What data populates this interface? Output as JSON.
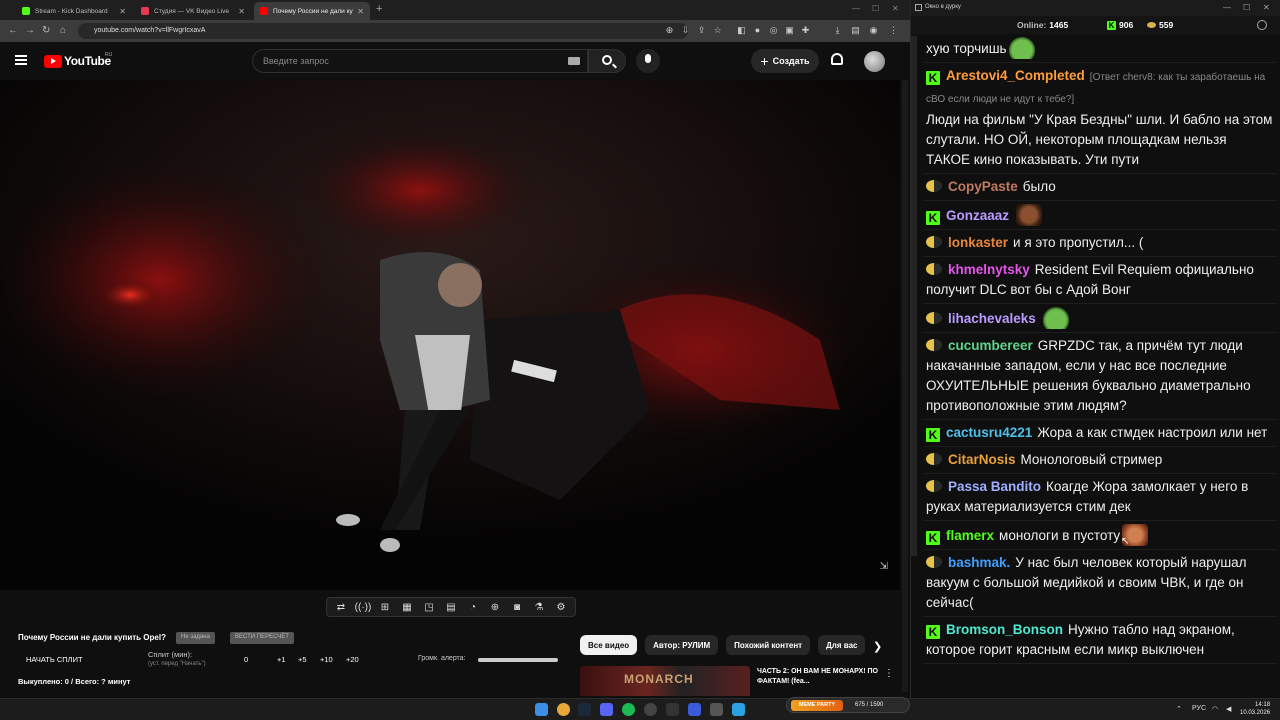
{
  "browser": {
    "tabs": [
      {
        "title": "Stream - Kick Dashboard",
        "color": "#53fc18"
      },
      {
        "title": "Студия — VK Видео Live",
        "color": "#e8384f"
      },
      {
        "title": "Почему России не дали купить",
        "color": "#ff0000"
      }
    ],
    "url": "youtube.com/watch?v=llFwgrIcxavA"
  },
  "youtube": {
    "logo_text": "YouTube",
    "region": "RU",
    "search_placeholder": "Введите запрос",
    "create_label": "Создать"
  },
  "below_video": {
    "title": "Почему России не дали купить Opel?",
    "pill1": "Не задана",
    "pill2": "ВЕСТИ ПЕРЕСЧЁТ",
    "split_button": "НАЧАТЬ СПЛИТ",
    "split_label": "Сплит (мин):",
    "split_sub": "(уст. перед \"Начать\")",
    "split_values": [
      "0",
      "+1",
      "+5",
      "+10",
      "+20"
    ],
    "volume_label": "Громк. алерта:",
    "bought": "Выкуплено: 0 / Всего: ? минут",
    "chips": [
      "Все видео",
      "Автор: РУЛИМ",
      "Похожий контент",
      "Для вас"
    ],
    "rec_title": "ЧАСТЬ 2: ОН ВАМ НЕ МОНАРХ! ПО ФАКТАМ! (fea...",
    "rec_thumb_text": "MONARCH"
  },
  "chat_window": {
    "title": "Окно в дурку",
    "online_label": "Online:",
    "online_value": "1465",
    "kick_count": "906",
    "vk_count": "559",
    "messages": [
      {
        "platform": "",
        "user": "",
        "color": "#ffffff",
        "reply": "",
        "text": "хую торчишь",
        "emote": "frog"
      },
      {
        "platform": "kick",
        "user": "Arestovi4_Completed",
        "color": "#ff9d3b",
        "reply": "[Ответ cherv8: как ты заработаешь на сВО если люди не идут к тебе?]",
        "text": "Люди на фильм \"У Края Бездны\" шли. И бабло на этом слутали. НО ОЙ, некоторым площадкам нельзя ТАКОЕ кино показывать. Ути пути",
        "emote": ""
      },
      {
        "platform": "vk",
        "user": "CopyPaste",
        "color": "#c17a5f",
        "reply": "",
        "text": "было",
        "emote": ""
      },
      {
        "platform": "kick",
        "user": "Gonzaaaz",
        "color": "#b89cff",
        "reply": "",
        "text": "",
        "emote": "face"
      },
      {
        "platform": "vk",
        "user": "lonkaster",
        "color": "#e8863a",
        "reply": "",
        "text": "и я это пропустил... (",
        "emote": ""
      },
      {
        "platform": "vk",
        "user": "khmelnytsky",
        "color": "#e455e8",
        "reply": "",
        "text": "Resident Evil Requiem официально получит DLC вот бы с Адой Вонг",
        "emote": ""
      },
      {
        "platform": "vk",
        "user": "lihachevaleks",
        "color": "#b89cff",
        "reply": "",
        "text": "",
        "emote": "frog"
      },
      {
        "platform": "vk",
        "user": "cucumbereer",
        "color": "#5fd48a",
        "reply": "",
        "text": "GRPZDC так, а причём тут люди накачанные западом, если у нас все последние ОХУИТЕЛЬНЫЕ решения буквально диаметрально противоположные этим людям?",
        "emote": ""
      },
      {
        "platform": "kick",
        "user": "cactusru4221",
        "color": "#4fc1e8",
        "reply": "",
        "text": "Жора а как стмдек настроил или нет",
        "emote": ""
      },
      {
        "platform": "vk",
        "user": "CitarNosis",
        "color": "#e8a23a",
        "reply": "",
        "text": "Монологовый стример",
        "emote": ""
      },
      {
        "platform": "vk",
        "user": "Passa Bandito",
        "color": "#9fb0ff",
        "reply": "",
        "text": "Коагде Жора замолкает у него в руках материализуется стим дек",
        "emote": ""
      },
      {
        "platform": "kick",
        "user": "flamerx",
        "color": "#53fc18",
        "reply": "",
        "text": "монологи в пустоту",
        "emote": "orange"
      },
      {
        "platform": "vk",
        "user": "bashmak.",
        "color": "#3fa0ff",
        "reply": "",
        "text": "У нас был человек который нарушал вакуум с большой медийкой и своим ЧВК, и где он сейчас(",
        "emote": ""
      },
      {
        "platform": "kick",
        "user": "Bromson_Bonson",
        "color": "#4fe8d0",
        "reply": "",
        "text": "Нужно табло над экраном, которое горит красным если микр выключен",
        "emote": ""
      }
    ]
  },
  "taskbar": {
    "lang": "РУС",
    "time": "14:18",
    "date": "10.03.2026",
    "meme_widget_label": "MEME PARTY",
    "meme_widget_count": "675 / 1590"
  }
}
